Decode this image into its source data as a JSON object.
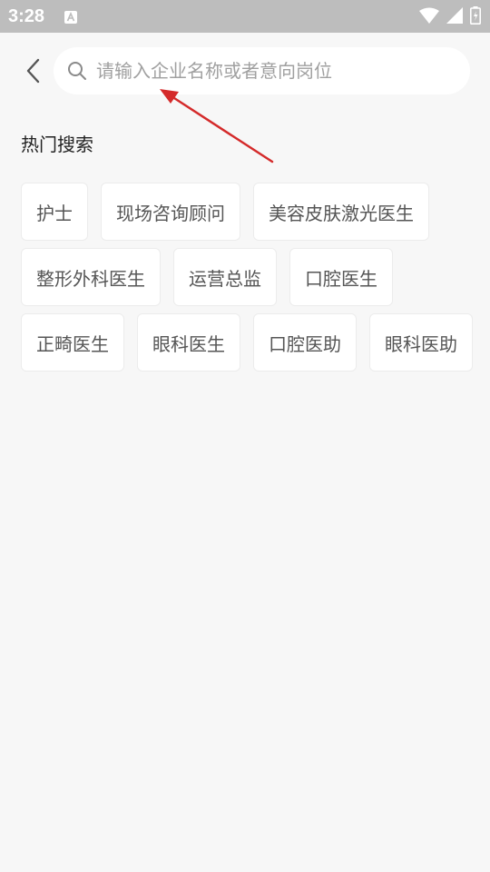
{
  "status_bar": {
    "time": "3:28",
    "icons": [
      "a-notification-icon",
      "wifi-icon",
      "signal-icon",
      "battery-charging-icon"
    ]
  },
  "search": {
    "placeholder": "请输入企业名称或者意向岗位",
    "value": ""
  },
  "hot_search": {
    "title": "热门搜索",
    "tags": [
      "护士",
      "现场咨询顾问",
      "美容皮肤激光医生",
      "整形外科医生",
      "运营总监",
      "口腔医生",
      "正畸医生",
      "眼科医生",
      "口腔医助",
      "眼科医助"
    ]
  },
  "colors": {
    "status_bar_bg": "#bdbdbd",
    "page_bg": "#f7f7f7",
    "annotation_arrow": "#d42a2a"
  }
}
